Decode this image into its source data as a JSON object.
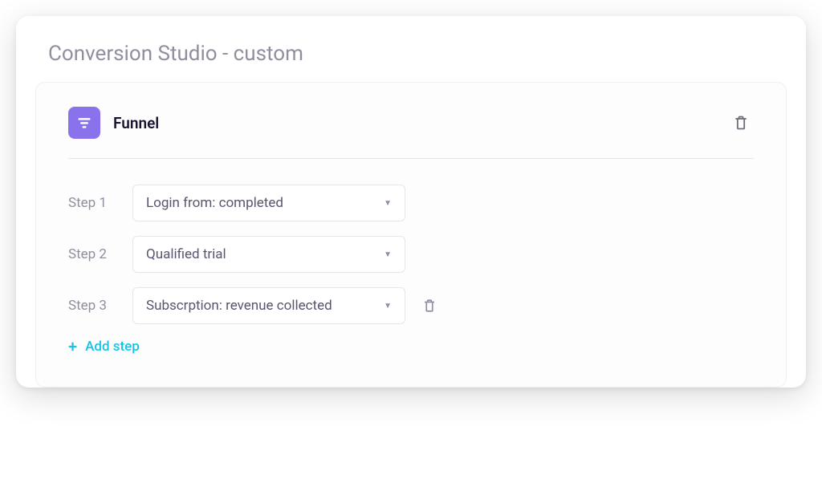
{
  "page_title": "Conversion Studio - custom",
  "funnel": {
    "title": "Funnel",
    "steps": [
      {
        "label": "Step 1",
        "value": "Login from: completed",
        "deletable": false
      },
      {
        "label": "Step 2",
        "value": "Qualified trial",
        "deletable": false
      },
      {
        "label": "Step 3",
        "value": "Subscrption: revenue collected",
        "deletable": true
      }
    ],
    "add_step_label": "Add step"
  },
  "colors": {
    "accent_purple": "#8a72ed",
    "accent_cyan": "#19c3e6",
    "text_muted": "#8f8f9f",
    "text_dark": "#1a1330"
  },
  "icons": {
    "funnel": "funnel-icon",
    "trash": "trash-icon",
    "plus": "plus-icon",
    "caret": "caret-down-icon"
  }
}
